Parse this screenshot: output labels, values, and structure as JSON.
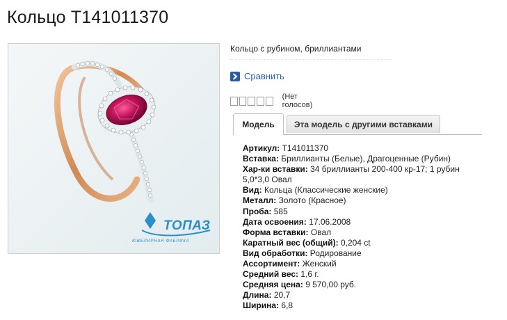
{
  "page": {
    "title": "Кольцо Т141011370"
  },
  "product_image": {
    "logo_text": "ТОПАЗ",
    "logo_subtext": "ЮВЕЛИРНАЯ ФАБРИКА",
    "colors": {
      "background": "#eef3f5",
      "gold": "#d89a6a",
      "ruby": "#c0145a",
      "logo": "#2a8fc9"
    }
  },
  "description": "Кольцо с рубином, бриллиантами",
  "compare": {
    "label": "Сравнить",
    "icon": "chevron-right-icon"
  },
  "rating": {
    "stars_total": 5,
    "stars_filled": 0,
    "votes_text": "(Нет голосов)"
  },
  "tabs": [
    {
      "label": "Модель",
      "active": true
    },
    {
      "label": "Эта модель с другими вставками",
      "active": false
    }
  ],
  "specs": [
    {
      "label": "Артикул:",
      "value": "Т141011370"
    },
    {
      "label": "Вставка:",
      "value": "Бриллианты (Белые), Драгоценные (Рубин)"
    },
    {
      "label": "Хар-ки вставки:",
      "value": "34 бриллианты 200-400 кр-17; 1 рубин 5,0*3,0 Овал"
    },
    {
      "label": "Вид:",
      "value": "Кольца (Классические женские)"
    },
    {
      "label": "Металл:",
      "value": "Золото (Красное)"
    },
    {
      "label": "Проба:",
      "value": "585"
    },
    {
      "label": "Дата освоения:",
      "value": "17.06.2008"
    },
    {
      "label": "Форма вставки:",
      "value": "Овал"
    },
    {
      "label": "Каратный вес (общий):",
      "value": "0,204 ct"
    },
    {
      "label": "Вид обработки:",
      "value": "Родирование"
    },
    {
      "label": "Ассортимент:",
      "value": "Женский"
    },
    {
      "label": "Средний вес:",
      "value": "1,6 г."
    },
    {
      "label": "Средняя цена:",
      "value": "9 570,00 руб."
    },
    {
      "label": "Длина:",
      "value": "20,7"
    },
    {
      "label": "Ширина:",
      "value": "6,8"
    }
  ]
}
